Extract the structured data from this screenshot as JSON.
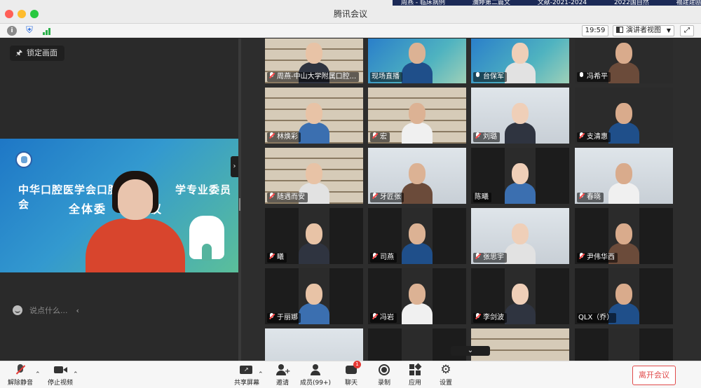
{
  "window": {
    "title": "腾讯会议"
  },
  "background_strip": [
    "周燕 - 临床病例",
    "瀰婷第二篇文",
    "文献-2021-2024",
    "2022国自然",
    "福建建瓯市"
  ],
  "toolbar": {
    "time": "19:59",
    "view_label": "演讲者视图"
  },
  "left": {
    "lock_label": "锁定画面",
    "slide_line1": "中华口腔医学会口腔",
    "slide_line1b": "学专业委员会",
    "slide_line2": "全体委",
    "slide_line2b": "议",
    "chat_placeholder": "说点什么..."
  },
  "participants": [
    {
      "name": "周燕-中山大学附属口腔...",
      "mic": "off",
      "bg": "shelves"
    },
    {
      "name": "现场直播",
      "mic": "none",
      "bg": "slide"
    },
    {
      "name": "台保军",
      "mic": "on",
      "bg": "slide"
    },
    {
      "name": "冯希平",
      "mic": "on",
      "bg": "dark"
    },
    {
      "name": "林焕彩",
      "mic": "off",
      "bg": "shelves"
    },
    {
      "name": "宏",
      "mic": "off",
      "bg": "shelves"
    },
    {
      "name": "刘璐",
      "mic": "off",
      "bg": "room"
    },
    {
      "name": "支清惠",
      "mic": "off",
      "bg": "dark"
    },
    {
      "name": "随遇而安",
      "mic": "off",
      "bg": "shelves"
    },
    {
      "name": "牙匠张",
      "mic": "off",
      "bg": "room"
    },
    {
      "name": "陈曦",
      "mic": "none",
      "bg": "dark"
    },
    {
      "name": "春晓",
      "mic": "off",
      "bg": "room"
    },
    {
      "name": "曦",
      "mic": "off",
      "bg": "dark"
    },
    {
      "name": "司燕",
      "mic": "off",
      "bg": "dark"
    },
    {
      "name": "张思宇",
      "mic": "off",
      "bg": "room"
    },
    {
      "name": "尹伟华西",
      "mic": "off",
      "bg": "dark"
    },
    {
      "name": "于丽娜",
      "mic": "off",
      "bg": "dark"
    },
    {
      "name": "冯岩",
      "mic": "off",
      "bg": "dark"
    },
    {
      "name": "李剑波",
      "mic": "off",
      "bg": "dark"
    },
    {
      "name": "QLX（乔）",
      "mic": "none",
      "bg": "dark"
    },
    {
      "name": "",
      "mic": "none",
      "bg": "room"
    },
    {
      "name": "",
      "mic": "none",
      "bg": "dark"
    },
    {
      "name": "",
      "mic": "none",
      "bg": "shelves"
    },
    {
      "name": "",
      "mic": "none",
      "bg": "dark"
    }
  ],
  "bottombar": {
    "unmute": "解除静音",
    "stop_video": "停止视频",
    "share_screen": "共享屏幕",
    "invite": "邀请",
    "members": "成员(99+)",
    "chat": "聊天",
    "chat_badge": "1",
    "record": "录制",
    "apps": "应用",
    "settings": "设置",
    "leave": "离开会议"
  }
}
